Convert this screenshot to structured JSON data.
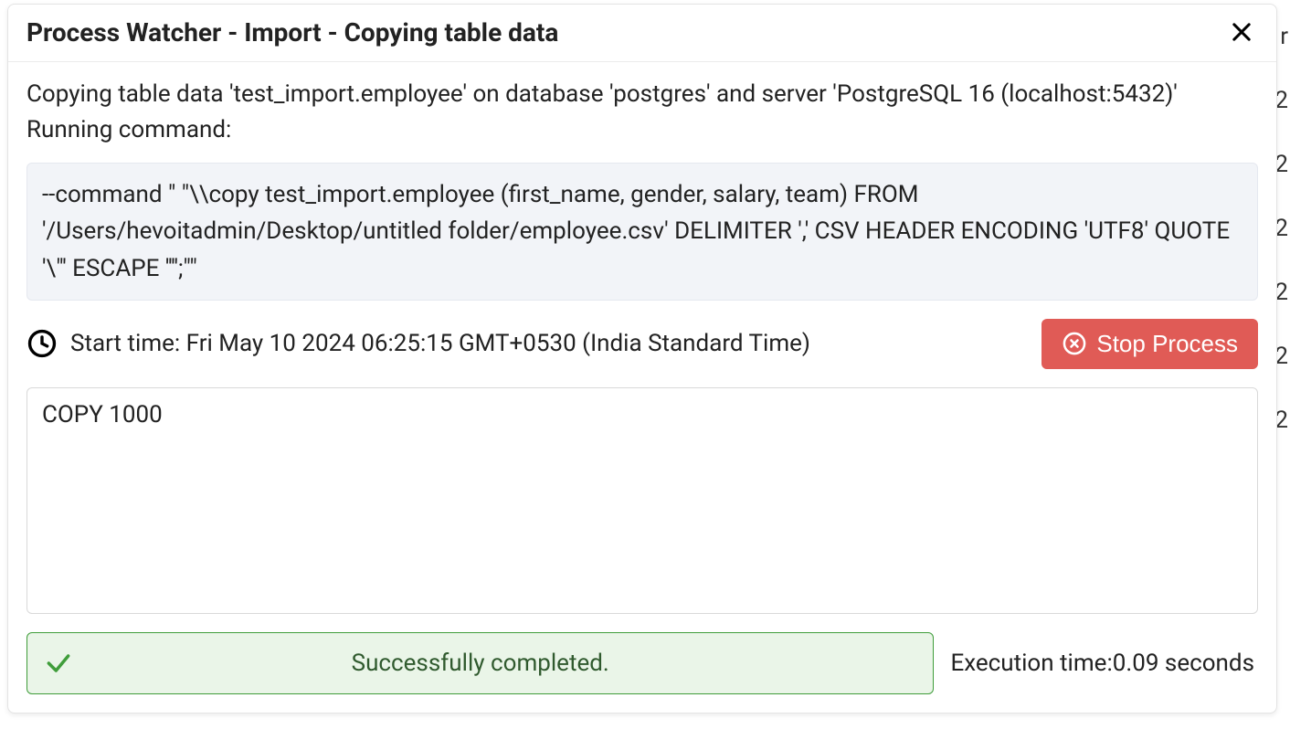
{
  "background": {
    "nums": [
      "r",
      "2",
      "2",
      "2",
      "2",
      "2",
      "2"
    ]
  },
  "dialog": {
    "title": "Process Watcher - Import - Copying table data",
    "description": "Copying table data 'test_import.employee' on database 'postgres' and server 'PostgreSQL 16 (localhost:5432)'",
    "running_label": "Running command:",
    "command": "--command \" \"\\\\copy test_import.employee (first_name, gender, salary, team) FROM '/Users/hevoitadmin/Desktop/untitled folder/employee.csv' DELIMITER ',' CSV HEADER ENCODING 'UTF8' QUOTE '\\\"' ESCAPE '''';\"\"",
    "start_time_label": "Start time: ",
    "start_time_value": "Fri May 10 2024 06:25:15 GMT+0530 (India Standard Time)",
    "stop_button": "Stop Process",
    "output": "COPY 1000",
    "success_message": "Successfully completed.",
    "execution_time_label": "Execution time: ",
    "execution_time_value": "0.09 seconds"
  }
}
